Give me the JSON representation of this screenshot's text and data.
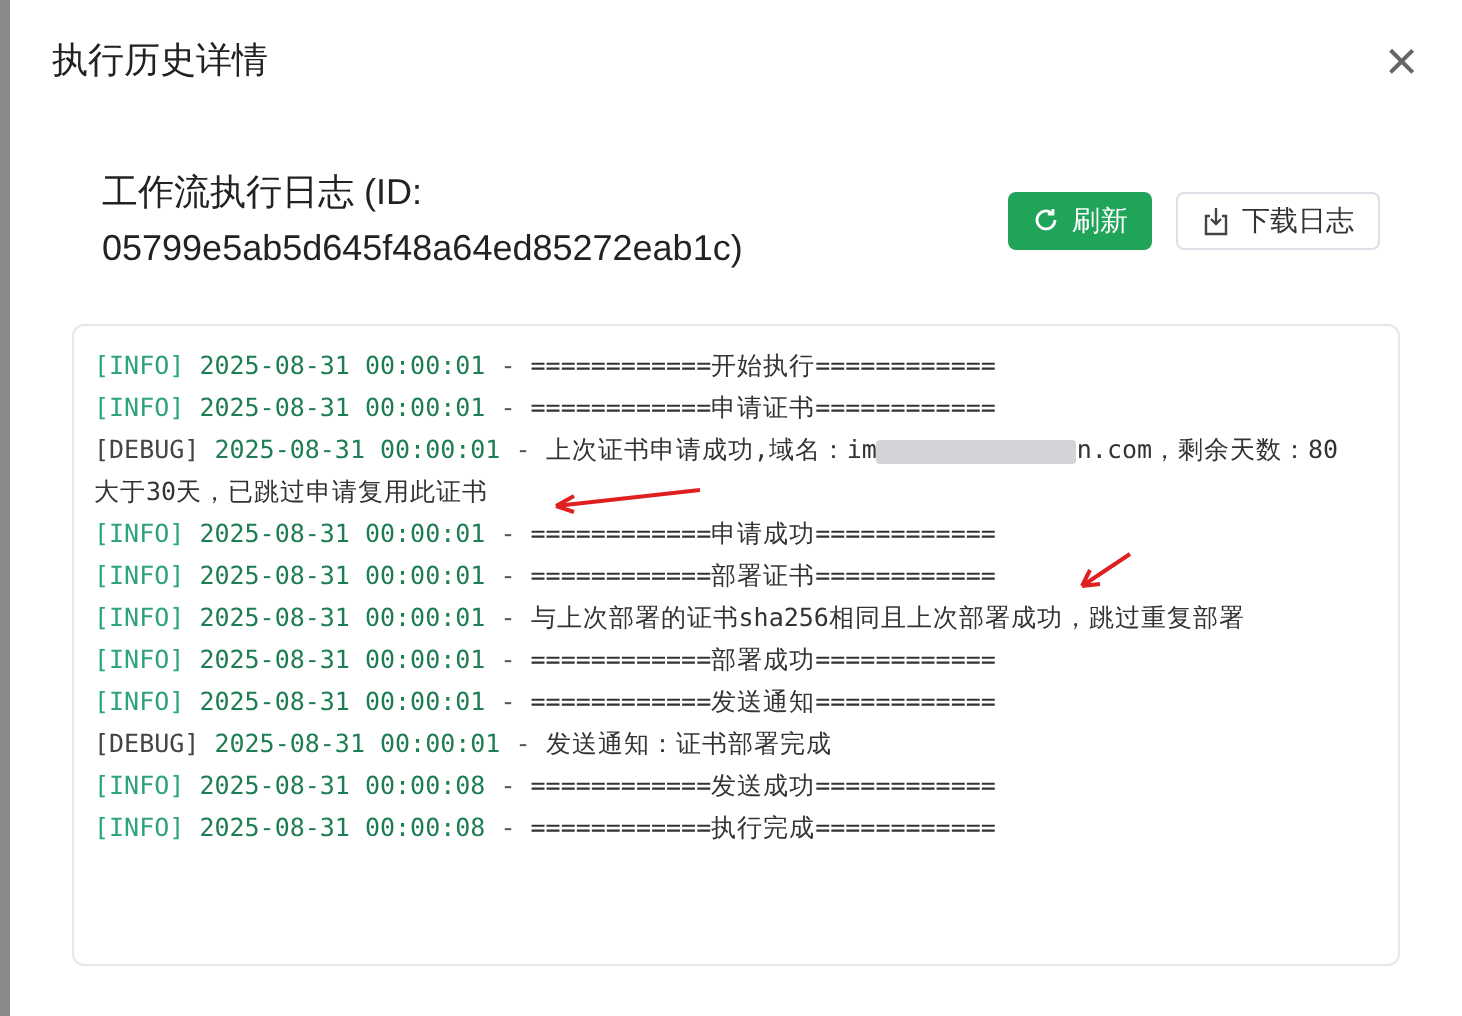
{
  "dialog": {
    "title": "执行历史详情",
    "close": "×"
  },
  "header": {
    "title": "工作流执行日志 (ID: 05799e5ab5d645f48a64ed85272eab1c)"
  },
  "buttons": [
    {
      "kind": "primary",
      "label": "刷新"
    },
    {
      "kind": "secondary",
      "label": "下载日志"
    }
  ],
  "log_lines": [
    {
      "kind": "info",
      "level": "[INFO]",
      "timestamp": "2025-08-31 00:00:01",
      "separator": "-",
      "segments": [
        {
          "kind": "text",
          "text": "============开始执行============"
        }
      ]
    },
    {
      "kind": "info",
      "level": "[INFO]",
      "timestamp": "2025-08-31 00:00:01",
      "separator": "-",
      "segments": [
        {
          "kind": "text",
          "text": "============申请证书============"
        }
      ]
    },
    {
      "kind": "debug",
      "level": "[DEBUG]",
      "timestamp": "2025-08-31 00:00:01",
      "separator": "-",
      "segments": [
        {
          "kind": "text",
          "text": "上次证书申请成功,域名：im"
        },
        {
          "kind": "redacted"
        },
        {
          "kind": "text",
          "text": "n.com，剩余天数：80"
        },
        {
          "kind": "continuation",
          "text": "大于30天，已跳过申请复用此证书"
        }
      ]
    },
    {
      "kind": "info",
      "level": "[INFO]",
      "timestamp": "2025-08-31 00:00:01",
      "separator": "-",
      "segments": [
        {
          "kind": "text",
          "text": "============申请成功============"
        }
      ]
    },
    {
      "kind": "info",
      "level": "[INFO]",
      "timestamp": "2025-08-31 00:00:01",
      "separator": "-",
      "segments": [
        {
          "kind": "text",
          "text": "============部署证书============"
        }
      ]
    },
    {
      "kind": "info",
      "level": "[INFO]",
      "timestamp": "2025-08-31 00:00:01",
      "separator": "-",
      "segments": [
        {
          "kind": "text",
          "text": "与上次部署的证书sha256相同且上次部署成功，跳过重复部署"
        }
      ]
    },
    {
      "kind": "info",
      "level": "[INFO]",
      "timestamp": "2025-08-31 00:00:01",
      "separator": "-",
      "segments": [
        {
          "kind": "text",
          "text": "============部署成功============"
        }
      ]
    },
    {
      "kind": "info",
      "level": "[INFO]",
      "timestamp": "2025-08-31 00:00:01",
      "separator": "-",
      "segments": [
        {
          "kind": "text",
          "text": "============发送通知============"
        }
      ]
    },
    {
      "kind": "debug",
      "level": "[DEBUG]",
      "timestamp": "2025-08-31 00:00:01",
      "separator": "-",
      "segments": [
        {
          "kind": "text",
          "text": "发送通知：证书部署完成"
        }
      ]
    },
    {
      "kind": "info",
      "level": "[INFO]",
      "timestamp": "2025-08-31 00:00:08",
      "separator": "-",
      "segments": [
        {
          "kind": "text",
          "text": "============发送成功============"
        }
      ]
    },
    {
      "kind": "info",
      "level": "[INFO]",
      "timestamp": "2025-08-31 00:00:08",
      "separator": "-",
      "segments": [
        {
          "kind": "text",
          "text": "============执行完成============"
        }
      ]
    }
  ]
}
